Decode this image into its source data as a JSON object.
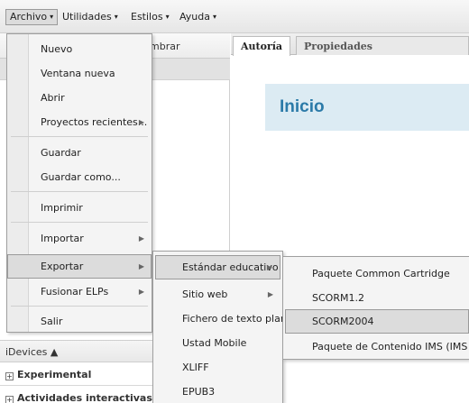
{
  "menubar": {
    "items": [
      {
        "label": "Archivo",
        "caret": "▾"
      },
      {
        "label": "Utilidades",
        "caret": "▾"
      },
      {
        "label": "Estilos",
        "caret": "▾"
      },
      {
        "label": "Ayuda",
        "caret": "▾"
      }
    ]
  },
  "outline": {
    "rename_label_partial": "mbrar"
  },
  "idevices": {
    "header": "iDevices ▲",
    "categories": [
      {
        "label": "Experimental"
      },
      {
        "label": "Actividades interactivas"
      }
    ]
  },
  "content": {
    "tabs": [
      {
        "label": "Autoría"
      },
      {
        "label": "Propiedades"
      }
    ],
    "page_title": "Inicio"
  },
  "archivo_menu": {
    "items": [
      {
        "label": "Nuevo"
      },
      {
        "label": "Ventana nueva"
      },
      {
        "label": "Abrir"
      },
      {
        "label": "Proyectos recientes..."
      },
      {
        "label": "Guardar"
      },
      {
        "label": "Guardar como..."
      },
      {
        "label": "Imprimir"
      },
      {
        "label": "Importar"
      },
      {
        "label": "Exportar"
      },
      {
        "label": "Fusionar ELPs"
      },
      {
        "label": "Salir"
      }
    ],
    "submenu_arrow": "▶"
  },
  "export_menu": {
    "items": [
      {
        "label": "Estándar educativo"
      },
      {
        "label": "Sitio web"
      },
      {
        "label": "Fichero de texto plano"
      },
      {
        "label": "Ustad Mobile"
      },
      {
        "label": "XLIFF"
      },
      {
        "label": "EPUB3"
      }
    ]
  },
  "standards_menu": {
    "items": [
      {
        "label": "Paquete Common Cartridge"
      },
      {
        "label": "SCORM1.2"
      },
      {
        "label": "SCORM2004"
      },
      {
        "label": "Paquete de Contenido IMS (IMS CP)"
      }
    ]
  },
  "colors": {
    "title_blue": "#2b7aa8",
    "banner_bg": "#dcebf3",
    "highlight": "#dcdcdc"
  }
}
